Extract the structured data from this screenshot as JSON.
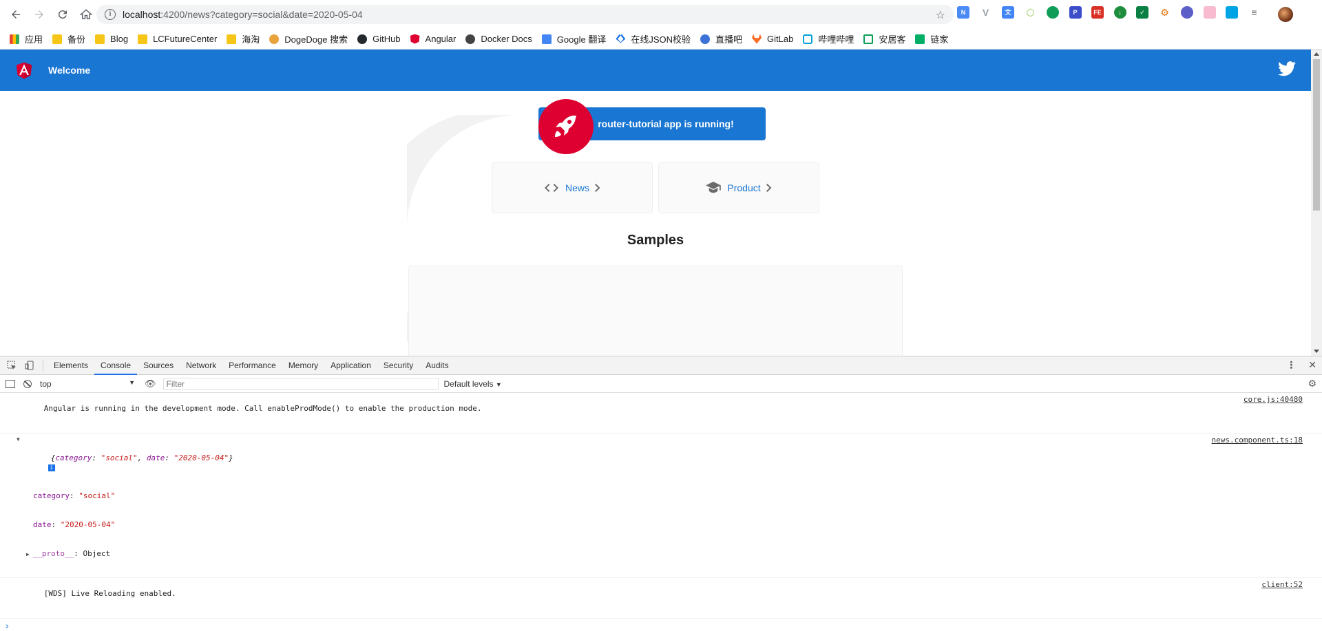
{
  "browser": {
    "url_host": "localhost",
    "url_rest": ":4200/news?category=social&date=2020-05-04",
    "bookmarks": [
      {
        "label": "应用",
        "icon": "apps-grid-icon"
      },
      {
        "label": "备份",
        "icon": "folder-icon"
      },
      {
        "label": "Blog",
        "icon": "folder-icon"
      },
      {
        "label": "LCFutureCenter",
        "icon": "folder-icon"
      },
      {
        "label": "海淘",
        "icon": "folder-icon"
      },
      {
        "label": "DogeDoge 搜索",
        "icon": "dogedoge-icon"
      },
      {
        "label": "GitHub",
        "icon": "github-icon"
      },
      {
        "label": "Angular",
        "icon": "angular-icon"
      },
      {
        "label": "Docker Docs",
        "icon": "docker-icon"
      },
      {
        "label": "Google 翻译",
        "icon": "google-translate-icon"
      },
      {
        "label": "在线JSON校验",
        "icon": "json-icon"
      },
      {
        "label": "直播吧",
        "icon": "zhibo8-icon"
      },
      {
        "label": "GitLab",
        "icon": "gitlab-icon"
      },
      {
        "label": "哔哩哔哩",
        "icon": "bilibili-icon"
      },
      {
        "label": "安居客",
        "icon": "anjuke-icon"
      },
      {
        "label": "链家",
        "icon": "lianjia-icon"
      }
    ]
  },
  "app": {
    "toolbar_title": "Welcome",
    "running_text": "router-tutorial app is running!",
    "cards": [
      {
        "label": "News",
        "icon": "code-brackets-icon"
      },
      {
        "label": "Product",
        "icon": "graduation-cap-icon"
      }
    ],
    "samples_title": "Samples"
  },
  "devtools": {
    "tabs": [
      "Elements",
      "Console",
      "Sources",
      "Network",
      "Performance",
      "Memory",
      "Application",
      "Security",
      "Audits"
    ],
    "active_tab": "Console",
    "context": "top",
    "filter_placeholder": "Filter",
    "levels": "Default levels",
    "logs": {
      "line1": "Angular is running in the development mode. Call enableProdMode() to enable the production mode.",
      "line1_src": "core.js:40480",
      "obj_summary_open": "{",
      "obj_summary_k1": "category",
      "obj_summary_v1": "\"social\"",
      "obj_summary_k2": "date",
      "obj_summary_v2": "\"2020-05-04\"",
      "obj_src": "news.component.ts:18",
      "prop1_key": "category",
      "prop1_val": "\"social\"",
      "prop2_key": "date",
      "prop2_val": "\"2020-05-04\"",
      "proto_key": "__proto__",
      "proto_val": "Object",
      "line3": "[WDS] Live Reloading enabled.",
      "line3_src": "client:52"
    }
  },
  "colors": {
    "angular_blue": "#1976d2",
    "angular_red": "#dd0031"
  }
}
